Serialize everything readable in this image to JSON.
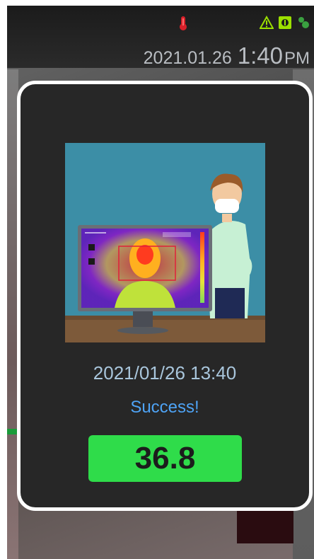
{
  "status_bar": {
    "date": "2021.01.26",
    "time": "1:40",
    "ampm": "PM",
    "icons": [
      "thermometer-icon",
      "warning-icon",
      "indicator-box-icon",
      "leaf-icon"
    ],
    "colors": {
      "thermometer": "#d8202a",
      "indicators": "#9be000"
    }
  },
  "result_card": {
    "illustration": "thermal-scan-illustration",
    "scan_time": "2021/01/26 13:40",
    "status": "Success!",
    "temperature": "36.8",
    "colors": {
      "status": "#4ea3f5",
      "temperature_bg": "#2fdc4a",
      "card_border": "#ffffff",
      "card_bg": "#272727"
    }
  }
}
